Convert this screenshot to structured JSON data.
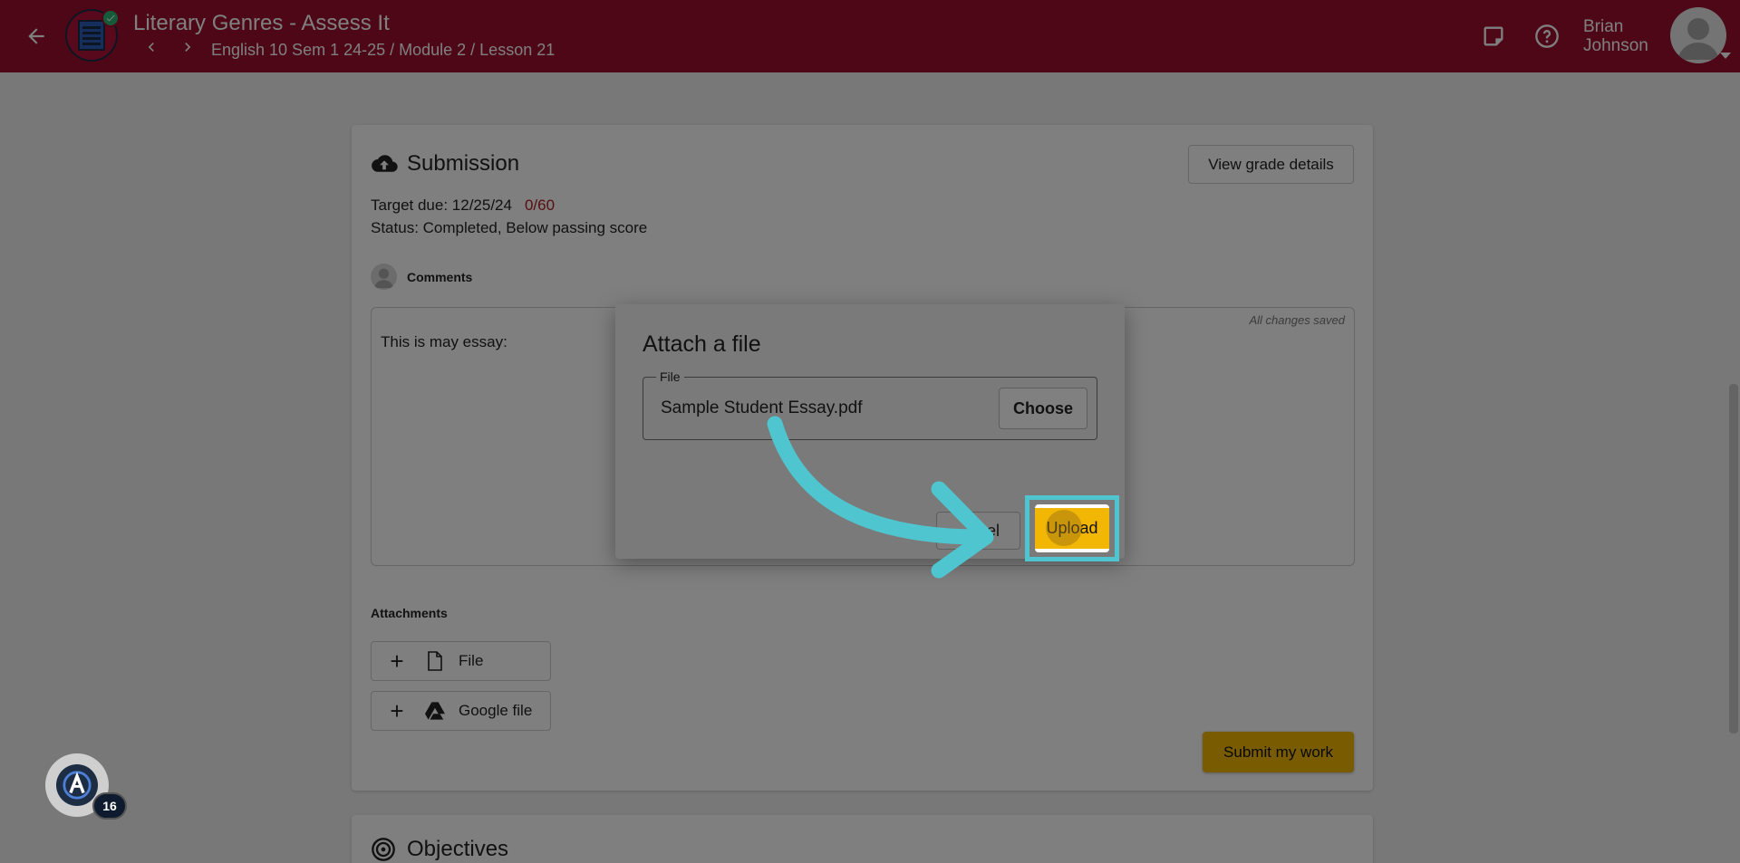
{
  "header": {
    "title": "Literary Genres - Assess It",
    "breadcrumb": "English 10 Sem 1 24-25 / Module 2 / Lesson 21",
    "user_name_first": "Brian",
    "user_name_last": "Johnson",
    "brand_color": "#9b0f2f"
  },
  "submission": {
    "title": "Submission",
    "view_grade_label": "View grade details",
    "target_due": "Target due: 12/25/24",
    "score": "0/60",
    "status": "Status: Completed, Below passing score",
    "comments_label": "Comments",
    "saved_text": "All changes saved",
    "essay_text": "This is may essay:",
    "attachments_label": "Attachments",
    "attach_file_label": "File",
    "attach_google_label": "Google file",
    "submit_label": "Submit my work",
    "accent_color": "#f2b705"
  },
  "objectives": {
    "title": "Objectives"
  },
  "dialog": {
    "title": "Attach a file",
    "field_label": "File",
    "field_value": "Sample Student Essay.pdf",
    "choose_label": "Choose",
    "cancel_label": "cel",
    "upload_label": "Upload",
    "highlight_color": "#4fc6cf"
  },
  "assistant": {
    "badge_count": "16"
  }
}
